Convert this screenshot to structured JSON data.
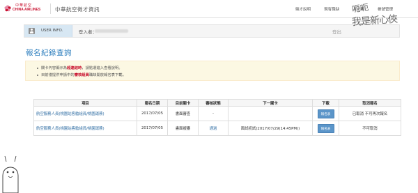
{
  "header": {
    "logo_cn": "中華航空",
    "logo_en": "CHINA AIRLINES",
    "site_title": "中華航空徵才資訊",
    "nav": [
      "徵才說明",
      "現有職缺",
      "人才庫",
      "帳號管理"
    ]
  },
  "userbar": {
    "label": "USER INFO.",
    "login_label": "登入者：",
    "logout": "登出"
  },
  "page": {
    "title": "報名紀錄查詢"
  },
  "notice": {
    "line1_prefix": "關卡內容顯示為",
    "line1_highlight": "超連結時",
    "line1_suffix": "，請點選進入查看說明。",
    "line2_prefix": "目前僅提供申請中的",
    "line2_highlight": "審核組員",
    "line2_suffix": "職缺開放報名表下載。"
  },
  "table": {
    "headers": [
      "項目",
      "報名日期",
      "目前關卡",
      "審核狀態",
      "下一關卡",
      "下載",
      "取消報名"
    ],
    "rows": [
      {
        "item": "航空服務人員(桃園站客艙組員/桃園運務)",
        "date": "2017/07/05",
        "stage": "書面審查",
        "status": "-",
        "next": "",
        "download": "報名表",
        "cancel": "已取消 不可再次報名"
      },
      {
        "item": "航空服務人員(桃園站客艙組員/桃園運務)",
        "date": "2017/07/05",
        "stage": "書面複審",
        "status": "通過",
        "next": "面試初試(2017/07/29(14:45PM))",
        "download": "報名表",
        "cancel": "不可取消"
      }
    ]
  },
  "watermark": {
    "line1": "呃呃",
    "line2": "我是新心俠"
  },
  "colors": {
    "brand_red": "#c8102e",
    "heading_blue": "#2f7fbe",
    "button_blue": "#5b95c9",
    "notice_bg": "#fcf8e3"
  },
  "icons": [
    "plum-blossom-logo-icon",
    "user-icon"
  ]
}
